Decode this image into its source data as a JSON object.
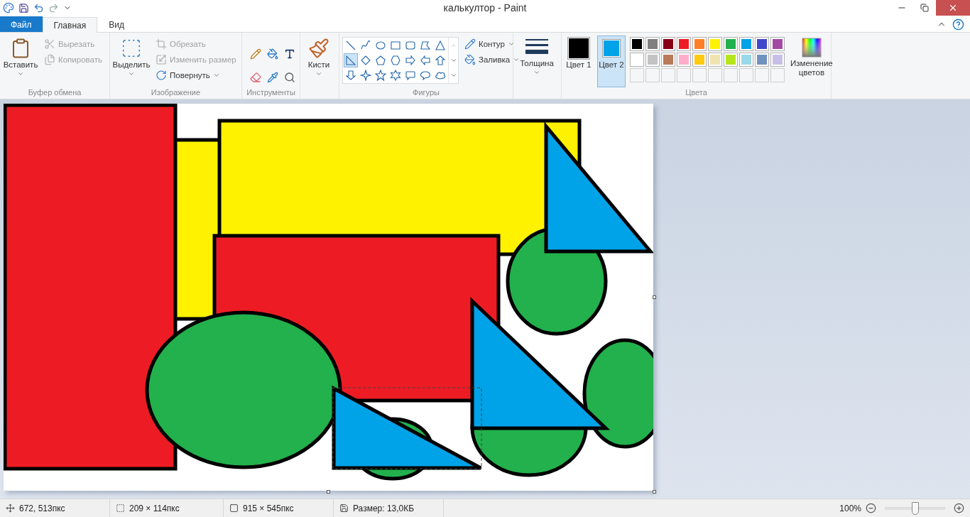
{
  "window": {
    "title": "калькултор - Paint"
  },
  "tabs": [
    {
      "label": "Файл",
      "kind": "file",
      "selected": false
    },
    {
      "label": "Главная",
      "kind": "tab",
      "selected": true
    },
    {
      "label": "Вид",
      "kind": "tab",
      "selected": false
    }
  ],
  "clipboard": {
    "label": "Буфер обмена",
    "paste": "Вставить",
    "cut": {
      "label": "Вырезать",
      "disabled": true
    },
    "copy": {
      "label": "Копировать",
      "disabled": true
    }
  },
  "image": {
    "label": "Изображение",
    "select": "Выделить",
    "crop": {
      "label": "Обрезать",
      "disabled": true
    },
    "resize": {
      "label": "Изменить размер",
      "disabled": true
    },
    "rotate": {
      "label": "Повернуть",
      "disabled": false
    }
  },
  "tools": {
    "label": "Инструменты"
  },
  "brushes": {
    "label": "Кисти"
  },
  "shapes": {
    "label": "Фигуры",
    "outline": "Контур",
    "fill": "Заливка",
    "items": [
      {
        "kind": "line",
        "selected": false
      },
      {
        "kind": "curve",
        "selected": false
      },
      {
        "kind": "oval",
        "selected": false
      },
      {
        "kind": "rect",
        "selected": false
      },
      {
        "kind": "roundrect",
        "selected": false
      },
      {
        "kind": "polygon",
        "selected": false
      },
      {
        "kind": "triangle",
        "selected": false
      },
      {
        "kind": "right-triangle",
        "selected": true
      },
      {
        "kind": "diamond",
        "selected": false
      },
      {
        "kind": "pentagon",
        "selected": false
      },
      {
        "kind": "hexagon",
        "selected": false
      },
      {
        "kind": "arrow-right",
        "selected": false
      },
      {
        "kind": "arrow-left",
        "selected": false
      },
      {
        "kind": "arrow-up",
        "selected": false
      },
      {
        "kind": "arrow-down",
        "selected": false
      },
      {
        "kind": "star4",
        "selected": false
      },
      {
        "kind": "star5",
        "selected": false
      },
      {
        "kind": "star6",
        "selected": false
      },
      {
        "kind": "callout-rect",
        "selected": false
      },
      {
        "kind": "callout-oval",
        "selected": false
      },
      {
        "kind": "callout-cloud",
        "selected": false
      }
    ]
  },
  "size": {
    "label": "Толщина"
  },
  "colors": {
    "label": "Цвета",
    "edit": "Изменение цветов",
    "active": [
      {
        "label": "Цвет 1",
        "color": "#000000",
        "selected": false
      },
      {
        "label": "Цвет 2",
        "color": "#00a2e8",
        "selected": true
      }
    ],
    "palette": [
      {
        "color": "#000000"
      },
      {
        "color": "#7f7f7f"
      },
      {
        "color": "#880015"
      },
      {
        "color": "#ed1c24"
      },
      {
        "color": "#ff7f27"
      },
      {
        "color": "#fff200"
      },
      {
        "color": "#22b14c"
      },
      {
        "color": "#00a2e8"
      },
      {
        "color": "#3f48cc"
      },
      {
        "color": "#a349a4"
      },
      {
        "color": "#ffffff"
      },
      {
        "color": "#c3c3c3"
      },
      {
        "color": "#b97a57"
      },
      {
        "color": "#ffaec9"
      },
      {
        "color": "#ffc90e"
      },
      {
        "color": "#efe4b0"
      },
      {
        "color": "#b5e61d"
      },
      {
        "color": "#99d9ea"
      },
      {
        "color": "#7092be"
      },
      {
        "color": "#c8bfe7"
      }
    ]
  },
  "status_bar": {
    "items": [
      {
        "kind": "cursor",
        "text": "672, 513пкс"
      },
      {
        "kind": "selection",
        "text": "209 × 114пкс"
      },
      {
        "kind": "canvas",
        "text": "915 × 545пкс"
      },
      {
        "kind": "file",
        "text": "Размер: 13,0КБ"
      }
    ],
    "zoom": {
      "text": "100%",
      "level": 0.5
    }
  }
}
